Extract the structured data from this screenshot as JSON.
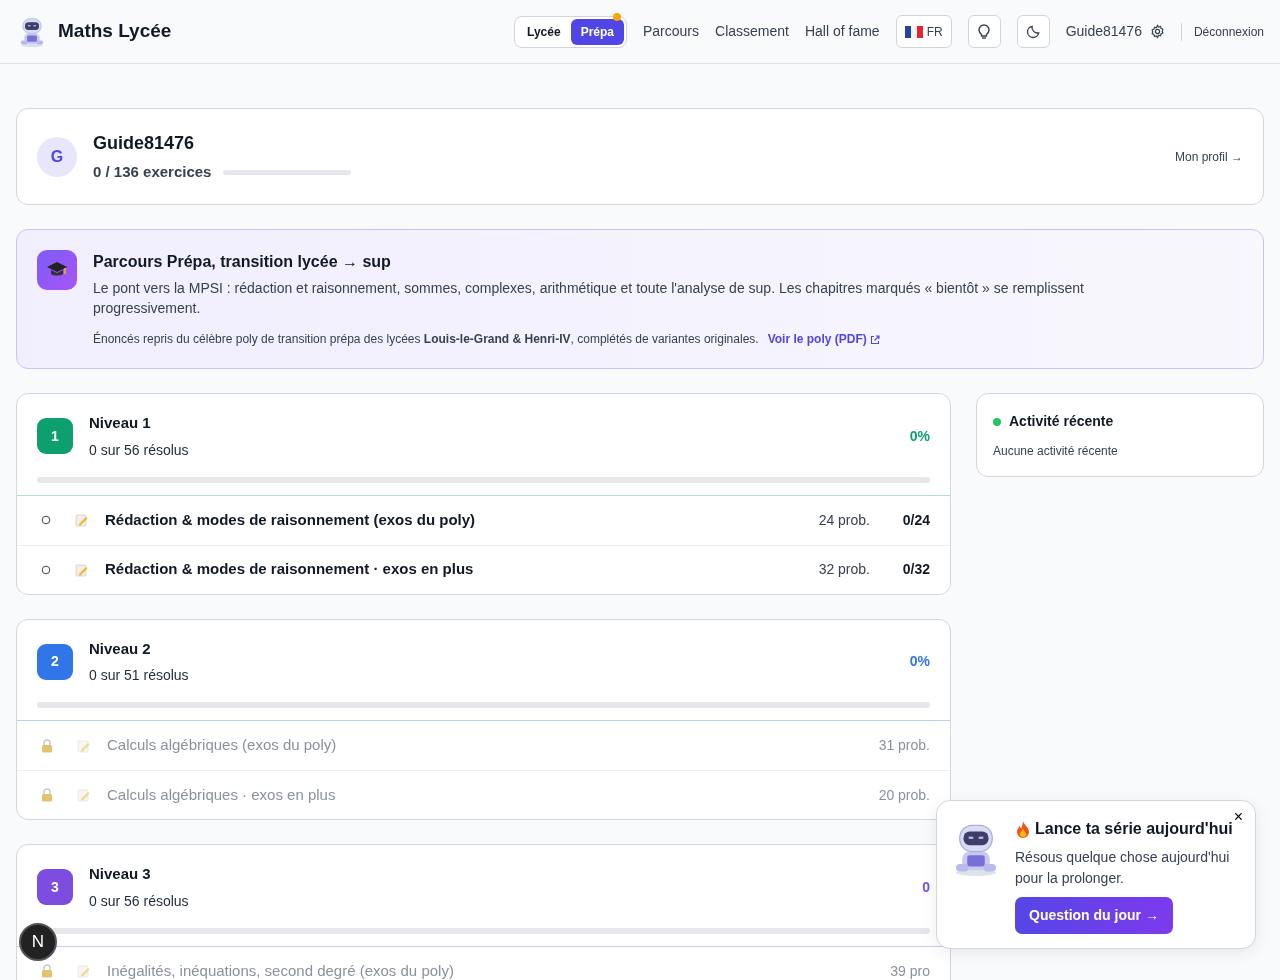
{
  "header": {
    "brand": "Maths Lycée",
    "mode_toggle": [
      {
        "label": "Lycée",
        "selected": false,
        "dot": false
      },
      {
        "label": "Prépa",
        "selected": true,
        "dot": true
      }
    ],
    "nav_links": [
      "Parcours",
      "Classement",
      "Hall of fame"
    ],
    "language": "FR",
    "username": "Guide81476",
    "logout": "Déconnexion"
  },
  "profile": {
    "initial": "G",
    "name": "Guide81476",
    "progress_text": "0 / 136 exercices",
    "level": 0,
    "link": "Mon profil →"
  },
  "banner": {
    "title": "Parcours Prépa, transition lycée → sup",
    "description": "Le pont vers la MPSI : rédaction et raisonnement, sommes, complexes, arithmétique et toute l'analyse de sup. Les chapitres marqués « bientôt » se remplissent progressivement.",
    "source": "Énoncés repris du célèbre poly de transition prépa des lycées **Louis-le-Grand & Henri-IV**, complétés de variantes originales.",
    "link": "Voir le poly (PDF)"
  },
  "levels": [
    {
      "number": "1",
      "title": "Niveau 1",
      "subtitle": "0 sur 56 résolus",
      "percent": "0%",
      "level": 0,
      "color": "#0e9f6e",
      "chapters": [
        {
          "title": "Rédaction & modes de raisonnement (exos du poly)",
          "count": "24 prob.",
          "score": "0/24",
          "locked": false
        },
        {
          "title": "Rédaction & modes de raisonnement · exos en plus",
          "count": "32 prob.",
          "score": "0/32",
          "locked": false
        }
      ]
    },
    {
      "number": "2",
      "title": "Niveau 2",
      "subtitle": "0 sur 51 résolus",
      "percent": "0%",
      "level": 0,
      "color": "#3076e8",
      "chapters": [
        {
          "title": "Calculs algébriques (exos du poly)",
          "count": "31 prob.",
          "locked": true
        },
        {
          "title": "Calculs algébriques · exos en plus",
          "count": "20 prob.",
          "locked": true
        }
      ]
    },
    {
      "number": "3",
      "title": "Niveau 3",
      "subtitle": "0 sur 56 résolus",
      "percent": "0",
      "level": 0,
      "color": "#7c4ddf",
      "chapters": [
        {
          "title": "Inégalités, inéquations, second degré (exos du poly)",
          "count": "39 pro",
          "locked": true
        }
      ]
    }
  ],
  "activity": {
    "title": "Activité récente",
    "empty_text": "Aucune activité récente"
  },
  "popup": {
    "title": "Lance ta série aujourd'hui",
    "body": "Résous quelque chose aujourd'hui pour la prolonger.",
    "button": "Question du jour →",
    "close": "×"
  },
  "dev_badge": "N"
}
